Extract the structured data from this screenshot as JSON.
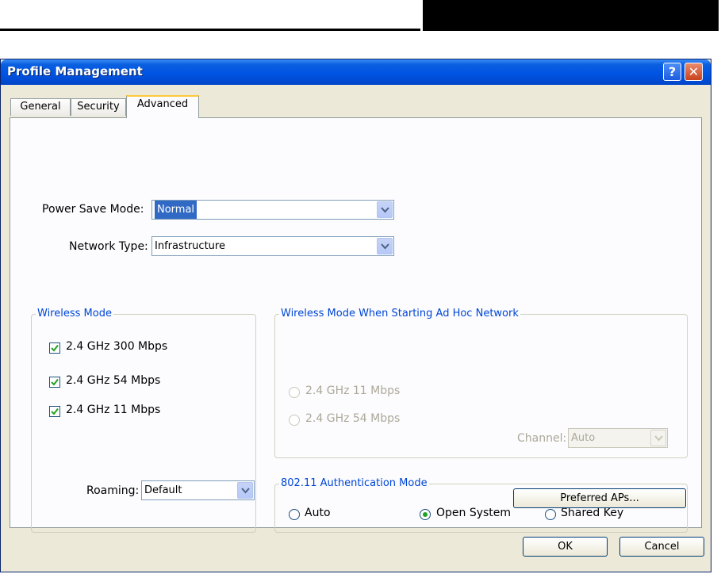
{
  "window": {
    "title": "Profile Management",
    "help_glyph": "?",
    "close_glyph": "✕"
  },
  "tabs": [
    {
      "label": "General"
    },
    {
      "label": "Security"
    },
    {
      "label": "Advanced"
    }
  ],
  "power_save": {
    "label": "Power Save Mode:",
    "value": "Normal"
  },
  "network_type": {
    "label": "Network Type:",
    "value": "Infrastructure"
  },
  "wireless_mode": {
    "title": "Wireless Mode",
    "options": [
      {
        "label": "2.4 GHz 300 Mbps",
        "checked": true
      },
      {
        "label": "2.4 GHz 54 Mbps",
        "checked": true
      },
      {
        "label": "2.4 GHz 11 Mbps",
        "checked": true
      }
    ]
  },
  "adhoc_mode": {
    "title": "Wireless Mode When Starting Ad Hoc Network",
    "options": [
      {
        "label": "2.4 GHz 11 Mbps"
      },
      {
        "label": "2.4 GHz 54 Mbps"
      }
    ],
    "channel_label": "Channel:",
    "channel_value": "Auto"
  },
  "auth_mode": {
    "title": "802.11 Authentication Mode",
    "options": [
      {
        "label": "Auto",
        "selected": false
      },
      {
        "label": "Open System",
        "selected": true
      },
      {
        "label": "Shared Key",
        "selected": false
      }
    ]
  },
  "roaming": {
    "label": "Roaming:",
    "value": "Default"
  },
  "buttons": {
    "preferred_aps": "Preferred APs...",
    "ok": "OK",
    "cancel": "Cancel"
  }
}
